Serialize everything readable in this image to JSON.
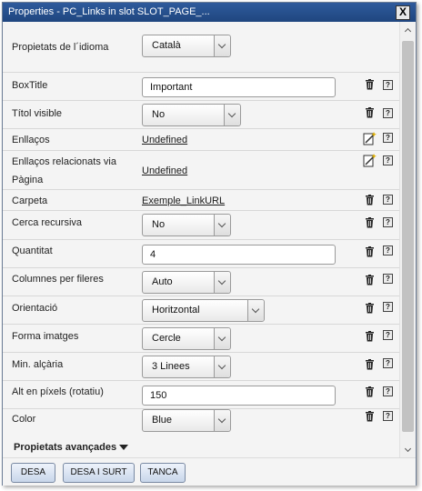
{
  "window": {
    "title": "Properties - PC_Links in slot SLOT_PAGE_...",
    "close_label": "X"
  },
  "rows": [
    {
      "label": "Propietats de l´idioma",
      "type": "select",
      "value": "Català"
    },
    {
      "label": "BoxTitle",
      "type": "text",
      "value": "Important"
    },
    {
      "label": "Títol visible",
      "type": "select",
      "value": "No"
    },
    {
      "label": "Enllaços",
      "type": "link",
      "value": "Undefined"
    },
    {
      "label": "Enllaços relacionats via Pàgina",
      "type": "link",
      "value": "Undefined"
    },
    {
      "label": "Carpeta",
      "type": "link",
      "value": "Exemple_LinkURL"
    },
    {
      "label": "Cerca recursiva",
      "type": "select",
      "value": "No"
    },
    {
      "label": "Quantitat",
      "type": "text",
      "value": "4"
    },
    {
      "label": "Columnes per fileres",
      "type": "select",
      "value": "Auto"
    },
    {
      "label": "Orientació",
      "type": "select",
      "value": "Horitzontal"
    },
    {
      "label": "Forma imatges",
      "type": "select",
      "value": "Cercle"
    },
    {
      "label": "Min. alçària",
      "type": "select",
      "value": "3 Linees"
    },
    {
      "label": "Alt en píxels (rotatiu)",
      "type": "text",
      "value": "150"
    },
    {
      "label": "Color",
      "type": "select",
      "value": "Blue"
    }
  ],
  "advanced": {
    "label": "Propietats avançades"
  },
  "icons": {
    "delete": "trash-icon",
    "help": "help-icon",
    "edit": "magic-wand-icon",
    "help_glyph": "?"
  },
  "buttons": {
    "save": "DESA",
    "save_exit": "DESA I SURT",
    "close": "TANCA"
  }
}
